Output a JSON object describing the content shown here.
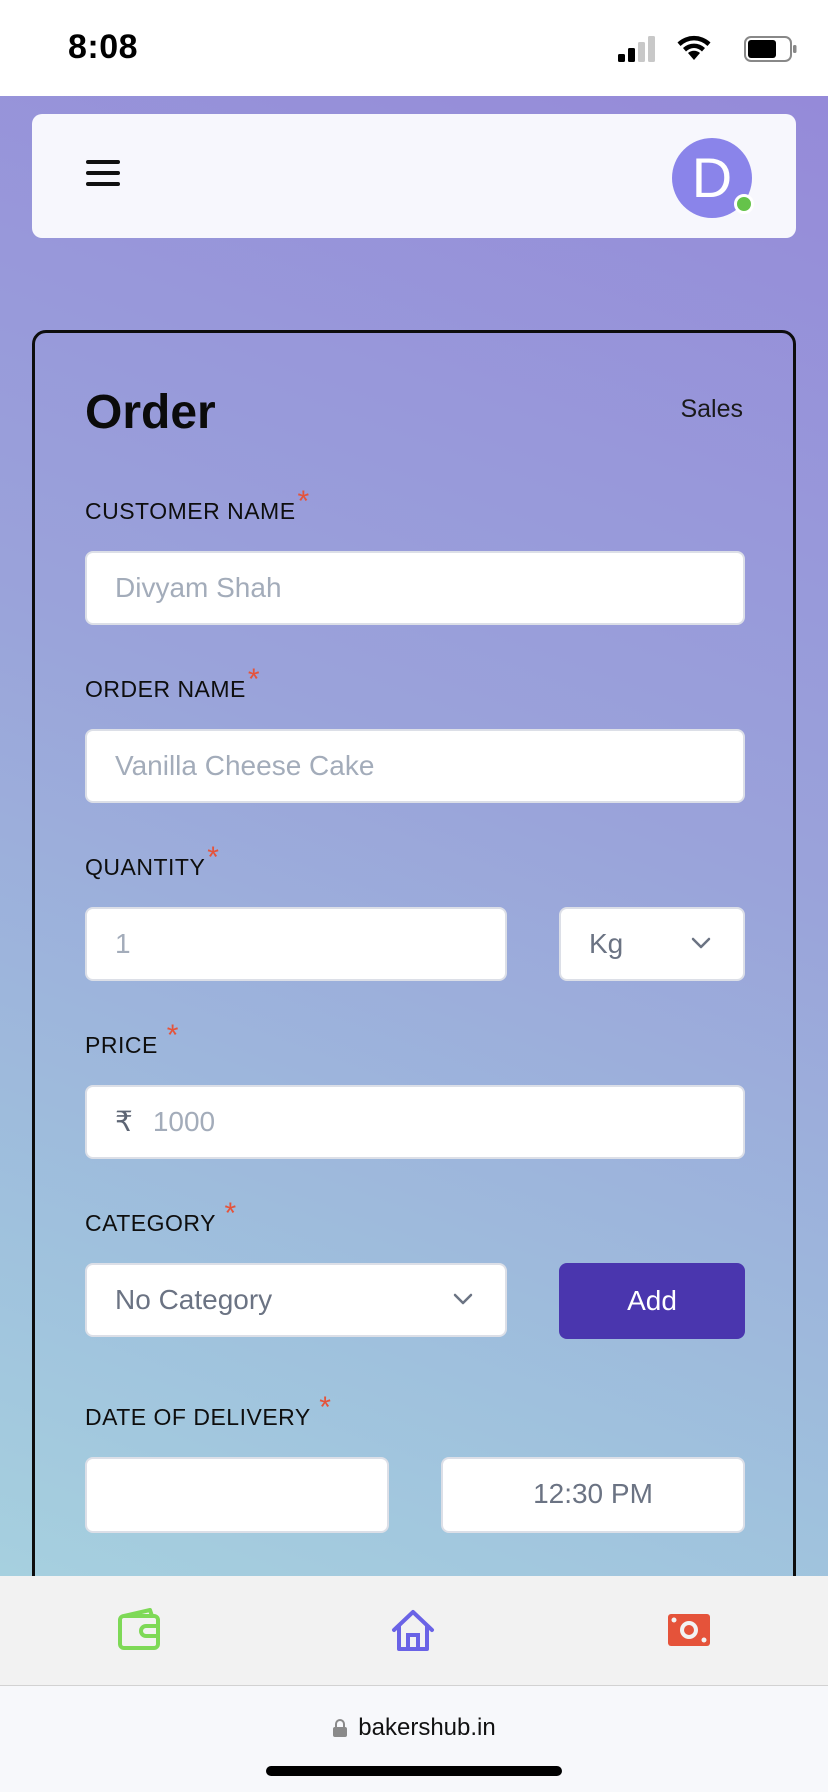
{
  "status_bar": {
    "time": "8:08"
  },
  "header": {
    "avatar_letter": "D"
  },
  "form": {
    "title": "Order",
    "sales_link": "Sales",
    "customer_name": {
      "label": "CUSTOMER NAME",
      "required": "*",
      "placeholder": "Divyam Shah"
    },
    "order_name": {
      "label": "ORDER NAME",
      "required": "*",
      "placeholder": "Vanilla Cheese Cake"
    },
    "quantity": {
      "label": "QUANTITY",
      "required": "*",
      "placeholder": "1",
      "unit": "Kg"
    },
    "price": {
      "label": "PRICE",
      "required": "*",
      "currency": "₹",
      "placeholder": "1000"
    },
    "category": {
      "label": "CATEGORY",
      "required": "*",
      "selected": "No Category",
      "add_label": "Add"
    },
    "delivery": {
      "label": "DATE OF DELIVERY",
      "required": "*",
      "date": "",
      "time": "12:30 PM"
    }
  },
  "bottom_nav": {
    "items": [
      "wallet-icon",
      "home-icon",
      "cash-icon"
    ]
  },
  "browser": {
    "url": "bakershub.in"
  },
  "colors": {
    "accent": "#4a36ae",
    "required": "#e5533a",
    "wallet": "#7ed957",
    "home": "#6a63e6",
    "cash": "#e5533a"
  }
}
